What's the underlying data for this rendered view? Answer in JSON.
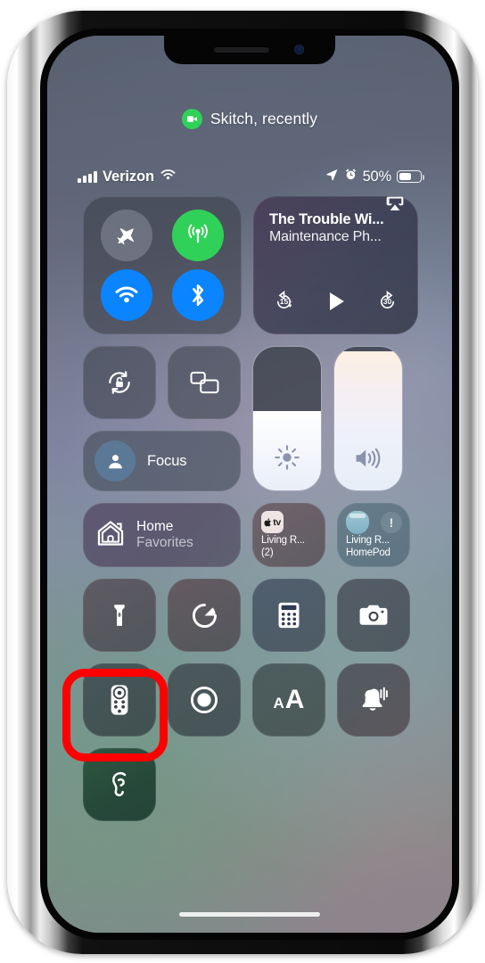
{
  "device": {
    "name": "iphone-frame"
  },
  "status": {
    "recent_app": {
      "label": "Skitch, recently",
      "icon": "screen-recording-icon",
      "badge_color": "#30d158"
    },
    "carrier": "Verizon",
    "wifi_icon": "wifi-icon",
    "signal_icon": "cellular-signal-icon",
    "location_icon": "location-arrow-icon",
    "alarm_icon": "alarm-clock-icon",
    "battery_percent": "50%",
    "battery_level": 50
  },
  "control_center": {
    "connectivity": {
      "airplane": {
        "name": "Airplane Mode",
        "state": "off",
        "color": "#969ca8"
      },
      "cellular": {
        "name": "Cellular Data",
        "state": "on",
        "color": "#30d158"
      },
      "wifi": {
        "name": "Wi-Fi",
        "state": "on",
        "color": "#0a84ff"
      },
      "bluetooth": {
        "name": "Bluetooth",
        "state": "on",
        "color": "#0a84ff"
      }
    },
    "media": {
      "title": "The Trouble Wi...",
      "subtitle": "Maintenance Ph...",
      "airplay_icon": "airplay-audio-icon",
      "skip_back_label": "15",
      "skip_forward_label": "30",
      "play_state": "paused"
    },
    "rotation_lock": {
      "label": "Rotation Lock",
      "icon": "rotation-lock-icon",
      "state": "off"
    },
    "screen_mirroring": {
      "label": "Screen Mirroring",
      "icon": "screen-mirroring-icon"
    },
    "focus": {
      "label": "Focus",
      "icon": "person-focus-icon"
    },
    "brightness": {
      "label": "Brightness",
      "value": 55,
      "icon": "sun-icon"
    },
    "volume": {
      "label": "Volume",
      "value": 97,
      "icon": "speaker-waves-icon"
    },
    "home": {
      "title": "Home",
      "subtitle": "Favorites",
      "icon": "home-house-icon"
    },
    "accessories": [
      {
        "badge": "tv",
        "badge_icon": "apple-tv-icon",
        "line1": "Living R...",
        "line2": "(2)"
      },
      {
        "badge_icon": "homepod-mini-icon",
        "alert": "!",
        "line1": "Living R...",
        "line2": "HomePod"
      }
    ],
    "shortcuts_row_1": [
      {
        "name": "flashlight",
        "icon": "flashlight-icon",
        "label": "Flashlight"
      },
      {
        "name": "timer",
        "icon": "timer-icon",
        "label": "Timer"
      },
      {
        "name": "calculator",
        "icon": "calculator-icon",
        "label": "Calculator"
      },
      {
        "name": "camera",
        "icon": "camera-icon",
        "label": "Camera"
      }
    ],
    "shortcuts_row_2": [
      {
        "name": "apple-tv-remote",
        "icon": "tv-remote-icon",
        "label": "Apple TV Remote"
      },
      {
        "name": "screen-recording",
        "icon": "screen-record-icon",
        "label": "Screen Recording"
      },
      {
        "name": "text-size",
        "icon": "text-size-icon",
        "label": "Text Size",
        "glyph": "AA"
      },
      {
        "name": "sound-recognition",
        "icon": "sound-recognition-bell-icon",
        "label": "Sound Recognition"
      }
    ],
    "hearing": {
      "name": "hearing",
      "icon": "ear-hearing-icon",
      "label": "Hearing",
      "state": "on",
      "highlighted": true
    }
  },
  "annotation": {
    "shape": "rectangle",
    "color": "#fe0000",
    "target": "hearing-control-button"
  }
}
